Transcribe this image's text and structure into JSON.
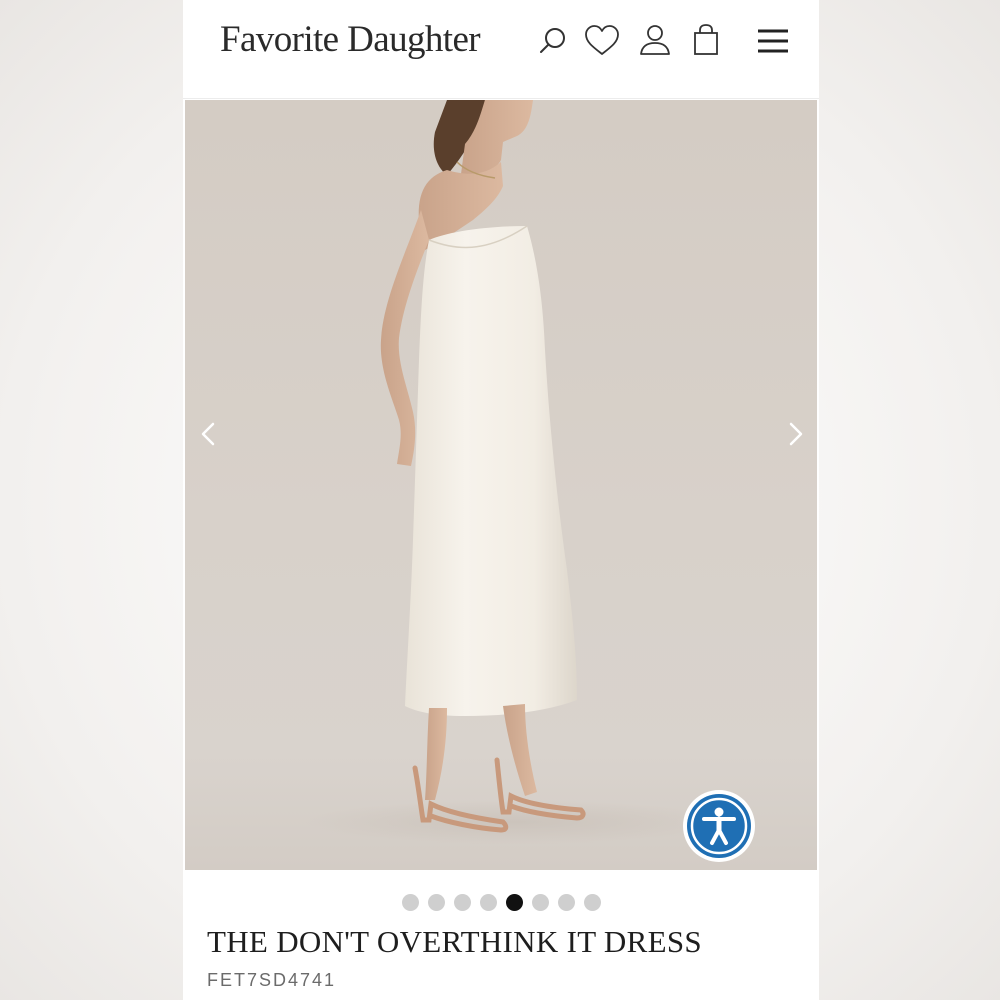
{
  "brand": {
    "logo_text": "Favorite Daughter"
  },
  "header": {
    "icons": [
      "search-icon",
      "heart-icon",
      "account-icon",
      "bag-icon",
      "menu-icon"
    ]
  },
  "gallery": {
    "image_count": 8,
    "active_index": 5,
    "prev_icon": "chevron-left-icon",
    "next_icon": "chevron-right-icon",
    "accessibility_icon": "accessibility-icon"
  },
  "product": {
    "title": "THE DON'T OVERTHINK IT DRESS",
    "sku": "FET7SD4741"
  },
  "colors": {
    "accessibility_blue": "#1f6fb4",
    "dot_active": "#111111",
    "dot_inactive": "#cfcfcf",
    "backdrop": "#d6cec6"
  }
}
